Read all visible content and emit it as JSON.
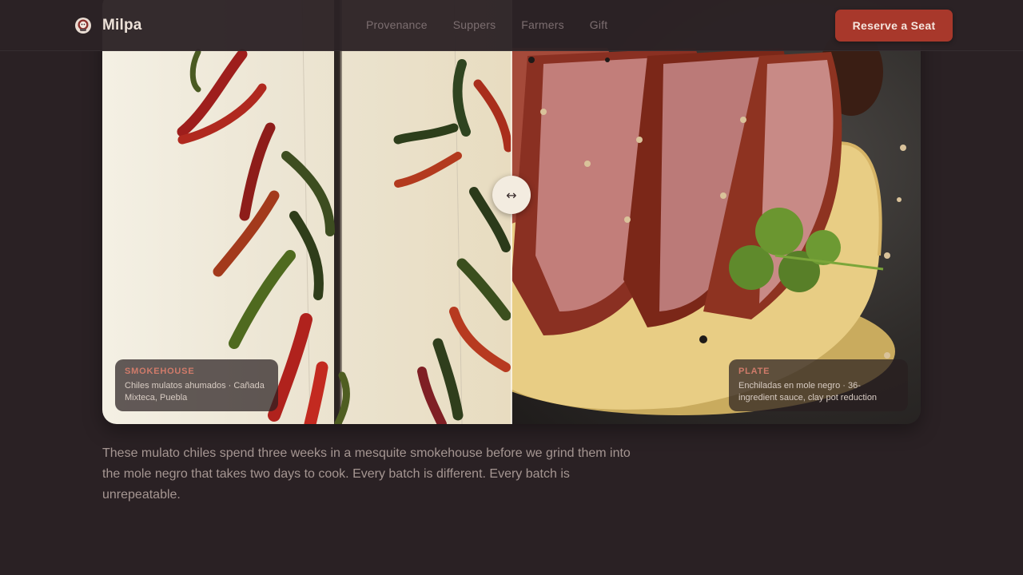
{
  "header": {
    "brand_name": "Milpa",
    "brand_icon": "chef-mark-icon",
    "nav": [
      {
        "label": "Provenance"
      },
      {
        "label": "Suppers"
      },
      {
        "label": "Farmers"
      },
      {
        "label": "Gift"
      }
    ],
    "cta_label": "Reserve a Seat"
  },
  "compare": {
    "handle_glyph": "↔",
    "left": {
      "tag": "SMOKEHOUSE",
      "text": "Chiles mulatos ahumados · Cañada Mixteca, Puebla",
      "image": "hanging dried chiles"
    },
    "right": {
      "tag": "PLATE",
      "text": "Enchiladas en mole negro · 36-ingredient sauce, clay pot reduction",
      "image": "sliced duck on masa with cilantro"
    }
  },
  "story": "These mulato chiles spend three weeks in a mesquite smokehouse before we grind them into the mole negro that takes two days to cook. Every batch is different. Every batch is unrepeatable.",
  "colors": {
    "background": "#2a2124",
    "accent": "#a8382b",
    "caption_tag": "#d07b6a"
  }
}
